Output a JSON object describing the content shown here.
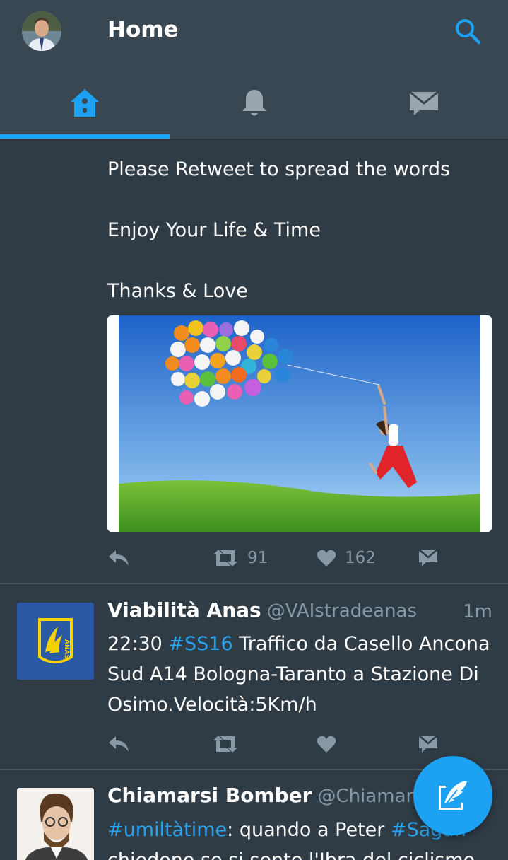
{
  "header": {
    "title": "Home",
    "search_icon": "search-icon",
    "avatar": "profile-avatar"
  },
  "tabs": [
    {
      "name": "home",
      "icon": "home-icon",
      "active": true
    },
    {
      "name": "notifications",
      "icon": "bell-icon",
      "active": false
    },
    {
      "name": "messages",
      "icon": "envelope-icon",
      "active": false
    }
  ],
  "colors": {
    "accent": "#1da1f2",
    "background": "#2f3b45",
    "header": "#394752",
    "muted": "#8899a6"
  },
  "tweets": [
    {
      "lines": [
        "Please Retweet to spread the words",
        "Enjoy Your Life & Time",
        "Thanks & Love"
      ],
      "media": "photo of woman leaping toward colorful balloons over green hill",
      "retweets": "91",
      "likes": "162"
    },
    {
      "author": "Viabilità Anas",
      "handle": "@VAIstradeanas",
      "time": "1m",
      "text_time": "22:30",
      "hashtag": "#SS16",
      "text_rest": " Traffico da Casello Ancona Sud A14 Bologna-Taranto a Stazione Di Osimo.Velocità:5Km/h",
      "logo_text": "ANAS"
    },
    {
      "author": "Chiamarsi Bomber",
      "handle": "@ChiamarsiB",
      "hashtag1": "#umiltàtime",
      "text_mid": ": quando a Peter ",
      "hashtag2": "#Sagan",
      "text_next": "chiedono se si sente l'Ibra del ciclismo"
    }
  ],
  "fab": {
    "icon": "compose-tweet-icon"
  }
}
